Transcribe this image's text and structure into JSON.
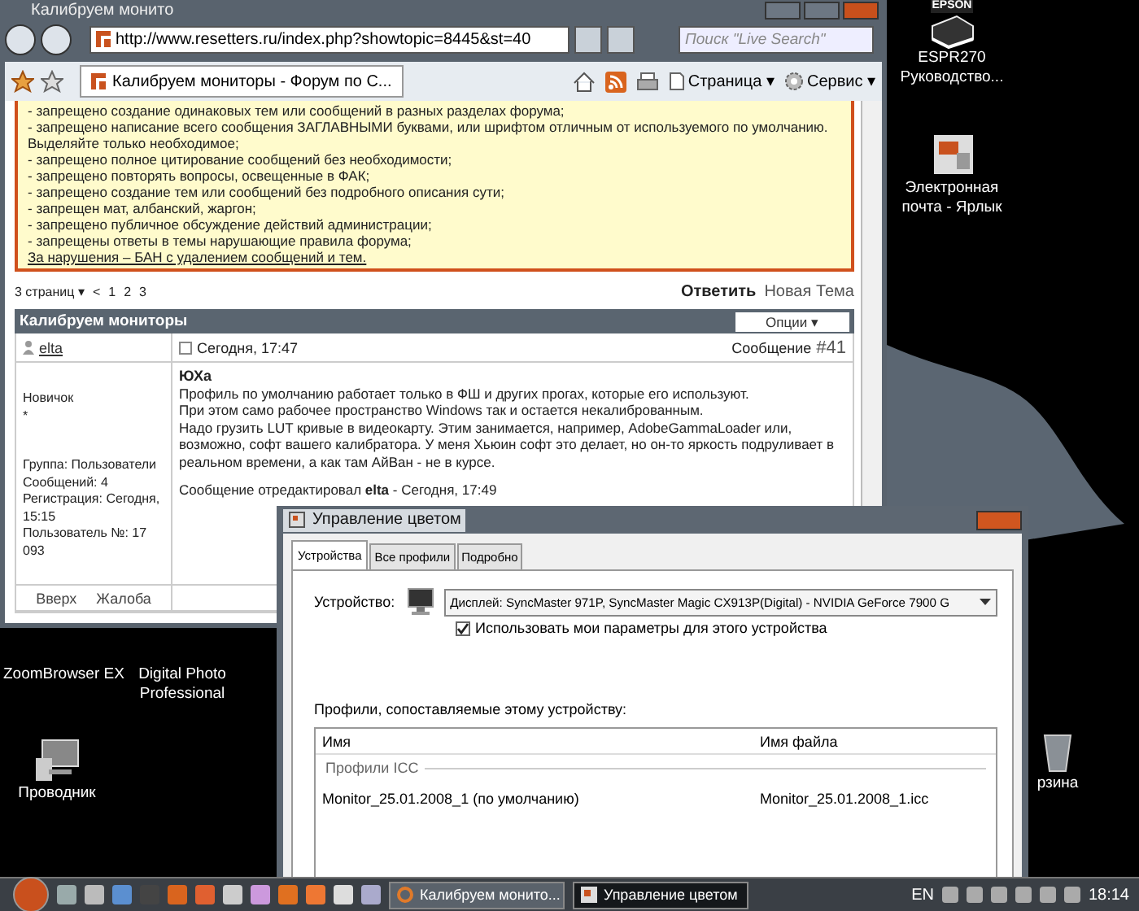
{
  "browser": {
    "title": "Калибруем монито",
    "url": "http://www.resetters.ru/index.php?showtopic=8445&st=40",
    "search_placeholder": "Поиск \"Live Search\"",
    "tab": "Калибруем мониторы - Форум по С...",
    "toolbar": [
      "Страница ▾",
      "Сервис ▾"
    ]
  },
  "forum": {
    "rules": [
      "- запрещено создание одинаковых тем или сообщений в разных разделах форума;",
      "- запрещено написание всего сообщения ЗАГЛАВНЫМИ буквами, или шрифтом отличным от используемого по умолчанию. Выделяйте только необходимое;",
      "- запрещено полное цитирование сообщений без необходимости;",
      "- запрещено повторять вопросы, освещенные в ФАК;",
      "- запрещено создание тем или сообщений без подробного описания сути;",
      "- запрещен мат, албанский, жаргон;",
      "- запрещено публичное обсуждение действий администрации;",
      "- запрещены ответы в темы нарушающие правила форума;"
    ],
    "rules_link": "За нарушения – БАН с удалением сообщений и тем.",
    "pages_label": "3 страниц ▾",
    "prev": "<",
    "pages": [
      "1",
      "2",
      "3"
    ],
    "reply": "Ответить",
    "new_topic": "Новая Тема",
    "topic_title": "Калибруем мониторы",
    "options": "Опции ▾",
    "post": {
      "author": "elta",
      "date": "Сегодня, 17:47",
      "number_label": "Сообщение",
      "number": "#41",
      "rank": "Новичок",
      "rank_mark": "*",
      "info": [
        "Группа: Пользователи",
        "Сообщений: 4",
        "Регистрация: Сегодня, 15:15",
        "Пользователь №: 17 093"
      ],
      "quote_author": "ЮХа",
      "body": [
        "Профиль по умолчанию работает только в ФШ и других прогах, которые его используют.",
        "При этом само рабочее пространство Windows так и остается некалиброванным.",
        "Надо грузить LUT кривые в видеокарту. Этим занимается, например, AdobeGammaLoader или, возможно, софт вашего калибратора. У меня Хьюин софт это делает, но он-то яркость подруливает в реальном времени, а как там АйВан - не в курсе."
      ],
      "edited": "Сообщение отредактировал **elta** - Сегодня, 17:49",
      "links": [
        "Вверх",
        "Жалоба"
      ]
    }
  },
  "desktop_icons": [
    {
      "kind": "hidden",
      "label": [
        "ZoomBrowser EX"
      ]
    },
    {
      "kind": "hidden",
      "label": [
        "Digital Photo",
        "Professional"
      ]
    },
    {
      "kind": "explorer",
      "label": [
        "Проводник"
      ]
    },
    {
      "kind": "printer",
      "badge": "EPSON",
      "label": [
        "ESPR270",
        "Руководство..."
      ]
    },
    {
      "kind": "mail",
      "label": [
        "Электронная",
        "почта - Ярлык"
      ]
    },
    {
      "kind": "bin",
      "label": [
        "рзина"
      ]
    }
  ],
  "dialog": {
    "title": "Управление цветом",
    "tabs": [
      {
        "label": "Устройства",
        "selected": true
      },
      {
        "label": "Все профили",
        "selected": false
      },
      {
        "label": "Подробно",
        "selected": false
      }
    ],
    "device_label": "Устройство:",
    "device": "Дисплей: SyncMaster 971P, SyncMaster Magic CX913P(Digital) - NVIDIA GeForce 7900 G",
    "use_settings": {
      "label": "Использовать мои параметры для этого устройства",
      "checked": true
    },
    "profiles_label": "Профили, сопоставляемые этому устройству:",
    "columns": [
      "Имя",
      "Имя файла"
    ],
    "group": "Профили ICC",
    "rows": [
      {
        "name": "Monitor_25.01.2008_1 (по умолчанию)",
        "file": "Monitor_25.01.2008_1.icc"
      }
    ]
  },
  "taskbar": {
    "tasks": [
      {
        "label": "Калибруем монито...",
        "selected": false,
        "kind": "browser"
      },
      {
        "label": "Управление цветом",
        "selected": true,
        "kind": "color"
      }
    ],
    "language": "EN",
    "clock": "18:14"
  }
}
